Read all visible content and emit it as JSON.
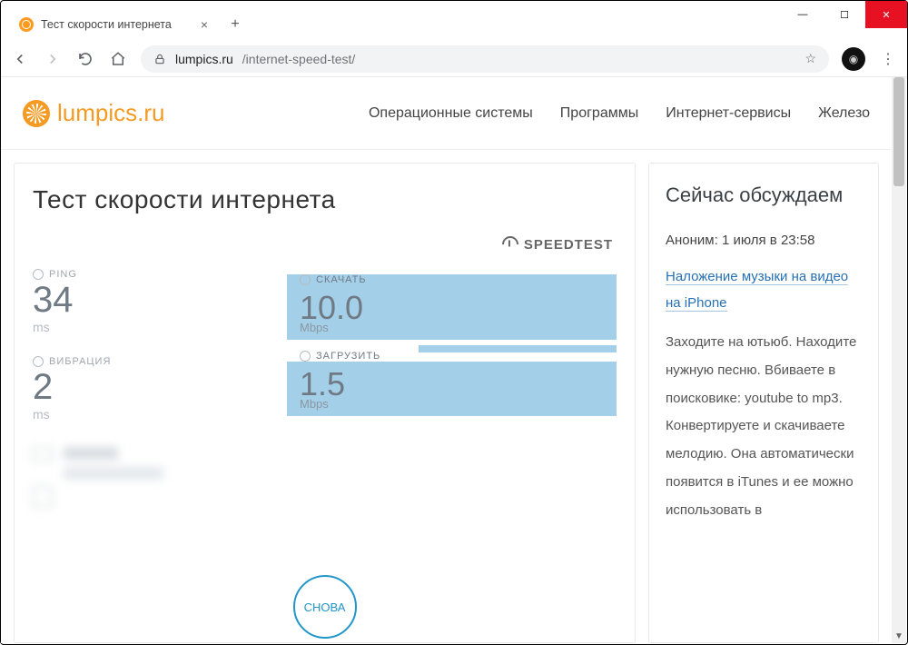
{
  "window": {
    "tab_title": "Тест скорости интернета"
  },
  "toolbar": {
    "url_domain": "lumpics.ru",
    "url_path": "/internet-speed-test/"
  },
  "site": {
    "logo_text": "lumpics.ru",
    "nav": [
      "Операционные системы",
      "Программы",
      "Интернет-сервисы",
      "Железо"
    ]
  },
  "page": {
    "title": "Тест скорости интернета",
    "speedtest_brand": "SPEEDTEST",
    "ping": {
      "label": "PING",
      "value": "34",
      "unit": "ms"
    },
    "jitter": {
      "label": "ВИБРАЦИЯ",
      "value": "2",
      "unit": "ms"
    },
    "download": {
      "label": "СКАЧАТЬ",
      "value": "10.0",
      "unit": "Mbps"
    },
    "upload": {
      "label": "ЗАГРУЗИТЬ",
      "value": "1.5",
      "unit": "Mbps"
    },
    "again_label": "СНОВА"
  },
  "sidebar": {
    "heading": "Сейчас обсуждаем",
    "comment": {
      "author": "Аноним:",
      "time": "1 июля в 23:58",
      "link_text": "Наложение музыки на видео на iPhone",
      "body": "Заходите на ютьюб. Находите нужную песню. Вбиваете в поисковике: youtube to mp3. Конвертируете и скачиваете мелодию. Она автоматически появится в iTunes и ее можно использовать в"
    }
  }
}
